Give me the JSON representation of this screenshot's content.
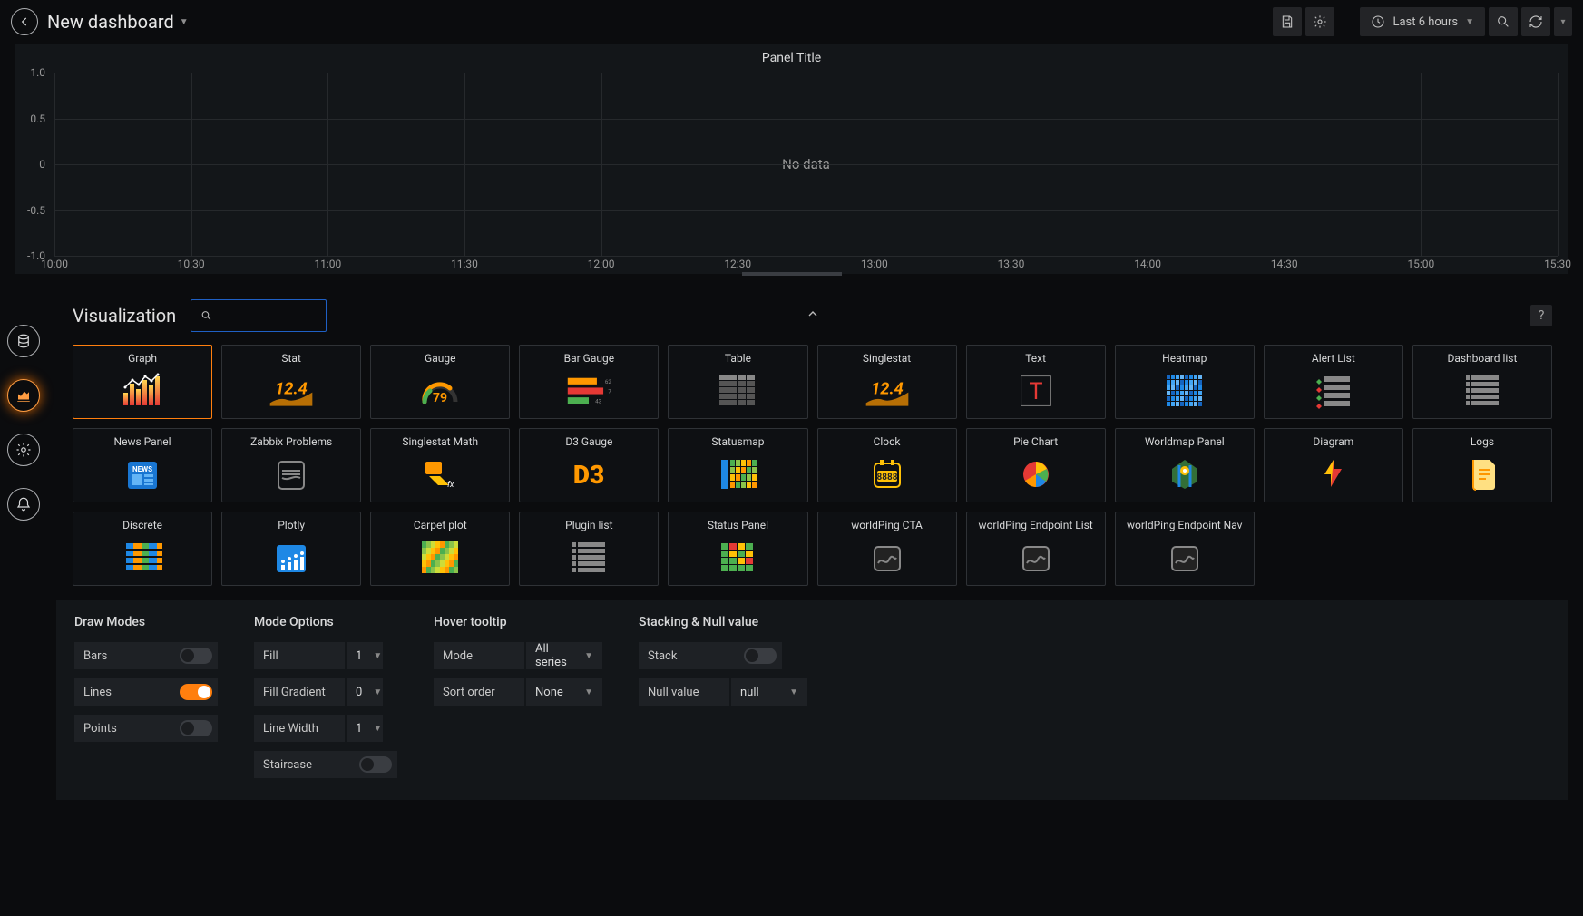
{
  "header": {
    "title": "New dashboard",
    "time_range": "Last 6 hours"
  },
  "panel": {
    "title": "Panel Title",
    "empty_message": "No data"
  },
  "chart_data": {
    "type": "line",
    "title": "Panel Title",
    "xlabel": "",
    "ylabel": "",
    "ylim": [
      -1.0,
      1.0
    ],
    "y_ticks": [
      "1.0",
      "0.5",
      "0",
      "-0.5",
      "-1.0"
    ],
    "x_ticks": [
      "10:00",
      "10:30",
      "11:00",
      "11:30",
      "12:00",
      "12:30",
      "13:00",
      "13:30",
      "14:00",
      "14:30",
      "15:00",
      "15:30"
    ],
    "series": []
  },
  "editor": {
    "section_title": "Visualization",
    "search_placeholder": "",
    "help_label": "?",
    "viz": [
      {
        "label": "Graph",
        "icon": "graph",
        "selected": true
      },
      {
        "label": "Stat",
        "icon": "stat"
      },
      {
        "label": "Gauge",
        "icon": "gauge"
      },
      {
        "label": "Bar Gauge",
        "icon": "bargauge"
      },
      {
        "label": "Table",
        "icon": "table"
      },
      {
        "label": "Singlestat",
        "icon": "singlestat"
      },
      {
        "label": "Text",
        "icon": "text"
      },
      {
        "label": "Heatmap",
        "icon": "heatmap"
      },
      {
        "label": "Alert List",
        "icon": "alertlist"
      },
      {
        "label": "Dashboard list",
        "icon": "dashlist"
      },
      {
        "label": "News Panel",
        "icon": "news"
      },
      {
        "label": "Zabbix Problems",
        "icon": "zabbix"
      },
      {
        "label": "Singlestat Math",
        "icon": "ssmath"
      },
      {
        "label": "D3 Gauge",
        "icon": "d3"
      },
      {
        "label": "Statusmap",
        "icon": "statusmap"
      },
      {
        "label": "Clock",
        "icon": "clock"
      },
      {
        "label": "Pie Chart",
        "icon": "pie"
      },
      {
        "label": "Worldmap Panel",
        "icon": "worldmap"
      },
      {
        "label": "Diagram",
        "icon": "diagram"
      },
      {
        "label": "Logs",
        "icon": "logs"
      },
      {
        "label": "Discrete",
        "icon": "discrete"
      },
      {
        "label": "Plotly",
        "icon": "plotly"
      },
      {
        "label": "Carpet plot",
        "icon": "carpet"
      },
      {
        "label": "Plugin list",
        "icon": "pluginlist"
      },
      {
        "label": "Status Panel",
        "icon": "statuspanel"
      },
      {
        "label": "worldPing CTA",
        "icon": "wpcta"
      },
      {
        "label": "worldPing Endpoint List",
        "icon": "wpel"
      },
      {
        "label": "worldPing Endpoint Nav",
        "icon": "wpen"
      }
    ]
  },
  "options": {
    "draw_modes": {
      "heading": "Draw Modes",
      "bars": {
        "label": "Bars",
        "value": false
      },
      "lines": {
        "label": "Lines",
        "value": true
      },
      "points": {
        "label": "Points",
        "value": false
      }
    },
    "mode_options": {
      "heading": "Mode Options",
      "fill": {
        "label": "Fill",
        "value": "1"
      },
      "fill_gradient": {
        "label": "Fill Gradient",
        "value": "0"
      },
      "line_width": {
        "label": "Line Width",
        "value": "1"
      },
      "staircase": {
        "label": "Staircase",
        "value": false
      }
    },
    "hover": {
      "heading": "Hover tooltip",
      "mode": {
        "label": "Mode",
        "value": "All series"
      },
      "sort": {
        "label": "Sort order",
        "value": "None"
      }
    },
    "stacking": {
      "heading": "Stacking & Null value",
      "stack": {
        "label": "Stack",
        "value": false
      },
      "null": {
        "label": "Null value",
        "value": "null"
      }
    }
  },
  "bargauge_values": {
    "a": "62",
    "b": "78",
    "c": "43"
  },
  "gauge_value": "79",
  "stat_value": "12.4"
}
